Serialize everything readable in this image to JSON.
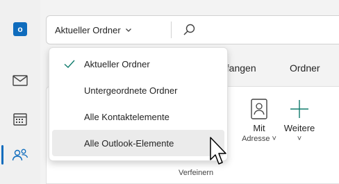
{
  "search": {
    "scope_label": "Aktueller Ordner",
    "scope_chevron": "chevron-down-icon",
    "search_icon": "search-icon"
  },
  "nav": {
    "items": [
      {
        "icon": "outlook-logo",
        "letter": "o"
      },
      {
        "icon": "mail-icon"
      },
      {
        "icon": "calendar-icon"
      },
      {
        "icon": "people-icon"
      }
    ]
  },
  "ribbon": {
    "tabs": [
      {
        "label": "pfangen"
      },
      {
        "label": "Ordner"
      }
    ],
    "commands": [
      {
        "label": "Mit",
        "sub": "Adresse ˅",
        "icon": "contact-card-icon"
      },
      {
        "label": "Weitere",
        "sub": "˅",
        "icon": "plus-icon"
      }
    ],
    "group_label": "Verfeinern"
  },
  "dropdown": {
    "items": [
      {
        "label": "Aktueller Ordner",
        "checked": true
      },
      {
        "label": "Untergeordnete Ordner",
        "checked": false
      },
      {
        "label": "Alle Kontaktelemente",
        "checked": false
      },
      {
        "label": "Alle Outlook-Elemente",
        "checked": false,
        "hovered": true
      }
    ]
  },
  "colors": {
    "accent": "#0f6cbd",
    "check": "#0f7b6c",
    "plus": "#0f7b6c"
  }
}
